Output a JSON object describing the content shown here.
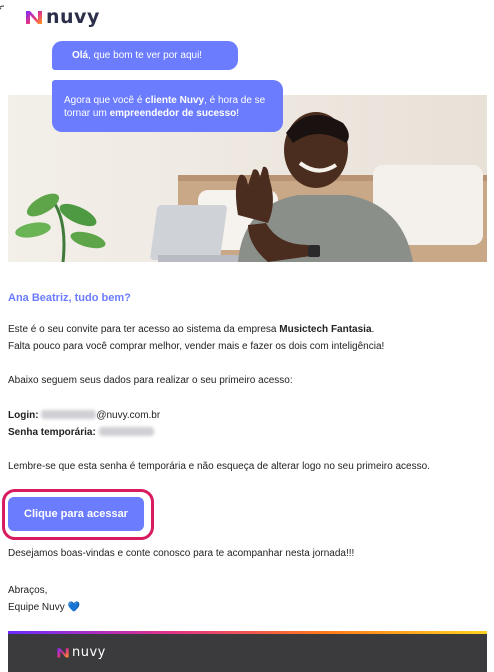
{
  "brand": {
    "name": "nuvy"
  },
  "bubbles": {
    "first": {
      "bold": "Olá",
      "rest": ", que bom te ver por aqui!"
    },
    "second": {
      "part1": "Agora que você é ",
      "bold1": "cliente Nuvy",
      "part2": ", é hora de se tornar um ",
      "bold2": "empreendedor de sucesso",
      "part3": "!"
    }
  },
  "message": {
    "greeting": "Ana Beatriz, tudo bem?",
    "invite_prefix": "Este é o seu convite para ter acesso ao sistema da empresa ",
    "company": "Musictech Fantasia",
    "invite_suffix": ".",
    "invite_line2": "Falta pouco para você comprar melhor, vender mais e fazer os dois com inteligência!",
    "dados": "Abaixo seguem seus dados para realizar o seu primeiro acesso:",
    "login_label": "Login:",
    "login_domain": "@nuvy.com.br",
    "password_label": "Senha temporária:",
    "reminder": "Lembre-se que esta senha é temporária e não esqueça de alterar logo no seu primeiro acesso.",
    "cta": "Clique para acessar",
    "welcome": "Desejamos boas-vindas e conte conosco para te acompanhar nesta jornada!!!",
    "closing": "Abraços,",
    "signature": "Equipe Nuvy",
    "heart": "💙"
  },
  "colors": {
    "accent": "#6b7cff",
    "highlight_ring": "#d81b60",
    "footer": "#3b3b3d"
  }
}
